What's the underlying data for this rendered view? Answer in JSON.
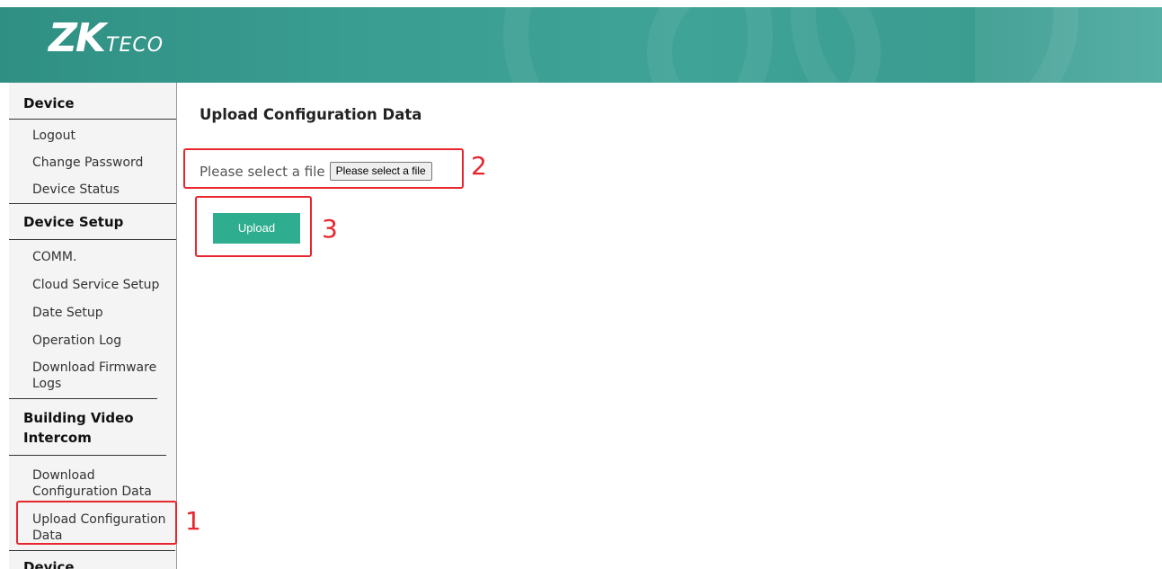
{
  "brand": {
    "logo_main": "ZK",
    "logo_sub": "TECO"
  },
  "sidebar": {
    "groups": [
      {
        "title": "Device",
        "items": [
          "Logout",
          "Change Password",
          "Device Status"
        ]
      },
      {
        "title": "Device Setup",
        "items": [
          "COMM.",
          "Cloud Service Setup",
          "Date Setup",
          "Operation Log",
          "Download Firmware Logs"
        ]
      },
      {
        "title": "Building Video Intercom",
        "items": [
          "Download Configuration Data",
          "Upload Configuration Data"
        ]
      },
      {
        "title": "Device"
      }
    ]
  },
  "main": {
    "title": "Upload Configuration Data",
    "file_label": "Please select a file",
    "file_button": "Please select a file",
    "upload_button": "Upload"
  },
  "annotations": {
    "step1": "1",
    "step2": "2",
    "step3": "3",
    "color": "#e8262d"
  },
  "colors": {
    "header": "#3a9d91",
    "upload_button": "#2eae8f"
  }
}
